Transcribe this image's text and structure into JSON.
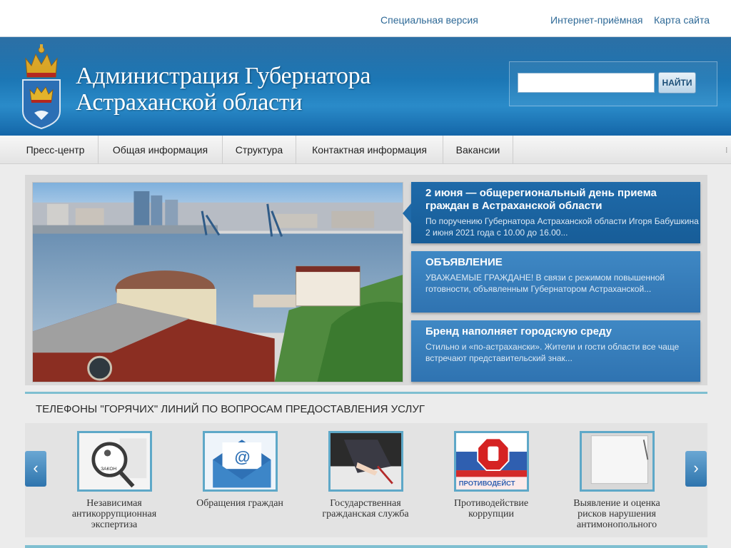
{
  "top_links": {
    "special_version": "Специальная версия",
    "reception": "Интернет-приёмная",
    "sitemap": "Карта сайта"
  },
  "header": {
    "title_line1": "Администрация Губернатора",
    "title_line2": "Астраханской области",
    "search_placeholder": "",
    "search_button": "НАЙТИ"
  },
  "nav": {
    "items": [
      "Пресс-центр",
      "Общая информация",
      "Структура",
      "Контактная информация",
      "Вакансии"
    ]
  },
  "news": [
    {
      "title": "2 июня — общерегиональный день приема граждан в Астраханской области",
      "text": "По поручению Губернатора Астраханской области Игоря Бабушкина 2 июня 2021 года с 10.00 до 16.00..."
    },
    {
      "title": "ОБЪЯВЛЕНИЕ",
      "text": "УВАЖАЕМЫЕ ГРАЖДАНЕ! В связи с режимом повышенной готовности, объявленным Губернатором Астраханской..."
    },
    {
      "title": "Бренд наполняет городскую среду",
      "text": "Стильно и «по-астрахански». Жители и гости области все чаще встречают представительский знак..."
    }
  ],
  "hotline": {
    "title": "ТЕЛЕФОНЫ \"ГОРЯЧИХ\" ЛИНИЙ ПО ВОПРОСАМ ПРЕДОСТАВЛЕНИЯ УСЛУГ",
    "prev_label": "‹",
    "next_label": "›",
    "items": [
      {
        "label": "Независимая антикоррупционная экспертиза",
        "thumb_caption": "ЗАКОН"
      },
      {
        "label": "Обращения граждан",
        "thumb_caption": "@"
      },
      {
        "label": "Государственная гражданская служба",
        "thumb_caption": ""
      },
      {
        "label": "Противодействие коррупции",
        "thumb_caption": "ПРОТИВОДЕЙСТ"
      },
      {
        "label": "Выявление и оценка рисков нарушения антимонопольного",
        "thumb_caption": ""
      }
    ]
  },
  "colors": {
    "link": "#2f6a97",
    "header_blue": "#1d78b6",
    "card_blue": "#2f73b1",
    "accent_line": "#7fbfd1"
  }
}
